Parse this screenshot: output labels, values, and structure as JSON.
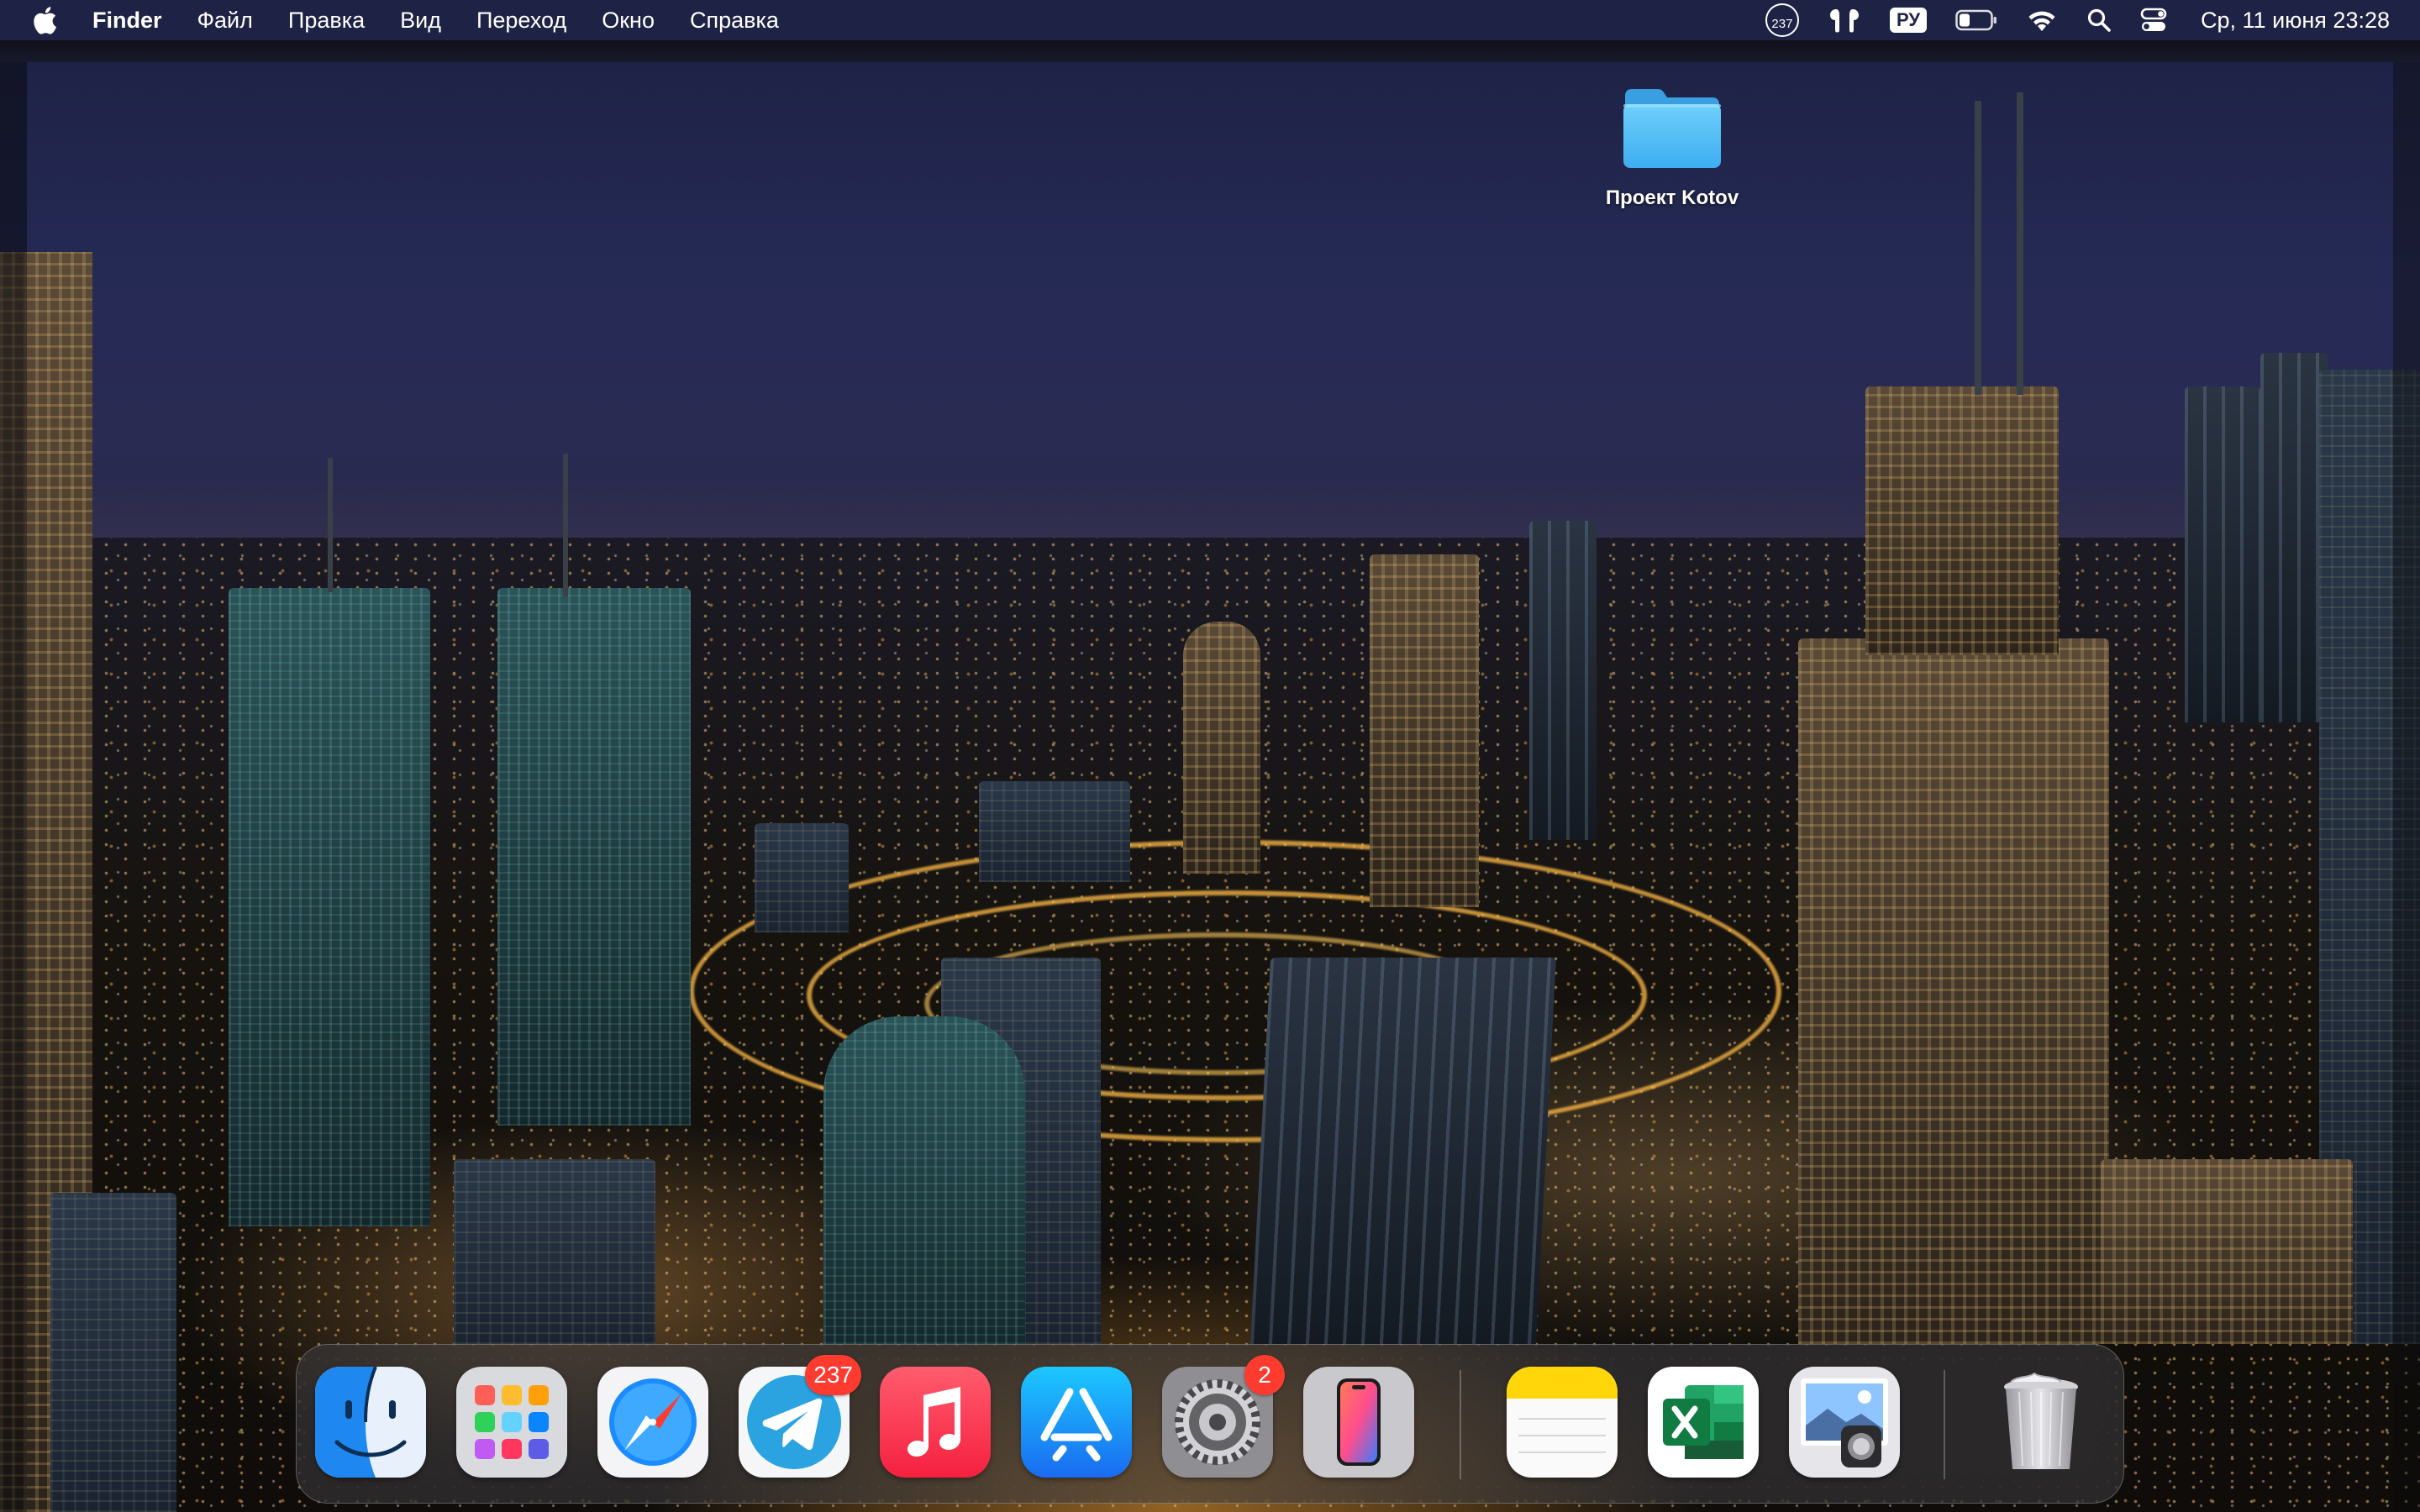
{
  "menubar": {
    "apple_icon": "apple-logo-icon",
    "app_name": "Finder",
    "items": [
      "Файл",
      "Правка",
      "Вид",
      "Переход",
      "Окно",
      "Справка"
    ],
    "status": {
      "workspace_count": "237",
      "airpods_icon": "airpods-icon",
      "input_language": "РУ",
      "battery_icon": "battery-icon",
      "wifi_icon": "wifi-icon",
      "search_icon": "spotlight-search-icon",
      "control_center_icon": "control-center-icon",
      "clock": "Ср, 11 июня  23:28"
    }
  },
  "desktop": {
    "icons": [
      {
        "label": "Проект Kotov",
        "type": "folder-icon",
        "color": "#5ac8fa"
      }
    ]
  },
  "dock": {
    "apps": [
      {
        "name": "Finder",
        "icon": "finder-icon",
        "running": true
      },
      {
        "name": "Launchpad",
        "icon": "launchpad-icon",
        "running": false
      },
      {
        "name": "Safari",
        "icon": "safari-icon",
        "running": true
      },
      {
        "name": "Telegram",
        "icon": "telegram-icon",
        "running": true,
        "badge": "237"
      },
      {
        "name": "Music",
        "icon": "music-icon",
        "running": false
      },
      {
        "name": "App Store",
        "icon": "app-store-icon",
        "running": false
      },
      {
        "name": "System Settings",
        "icon": "system-settings-icon",
        "running": true,
        "badge": "2"
      },
      {
        "name": "iPhone Mirroring",
        "icon": "iphone-mirroring-icon",
        "running": false
      },
      {
        "name": "Notes",
        "icon": "notes-icon",
        "running": true
      },
      {
        "name": "Microsoft Excel",
        "icon": "excel-icon",
        "running": false
      },
      {
        "name": "Preview",
        "icon": "preview-icon",
        "running": false
      },
      {
        "name": "Trash",
        "icon": "trash-icon",
        "running": false
      }
    ]
  },
  "colors": {
    "menubar_bg": "#1e2446",
    "badge_red": "#ff3b30",
    "folder_blue": "#5ac8fa"
  }
}
